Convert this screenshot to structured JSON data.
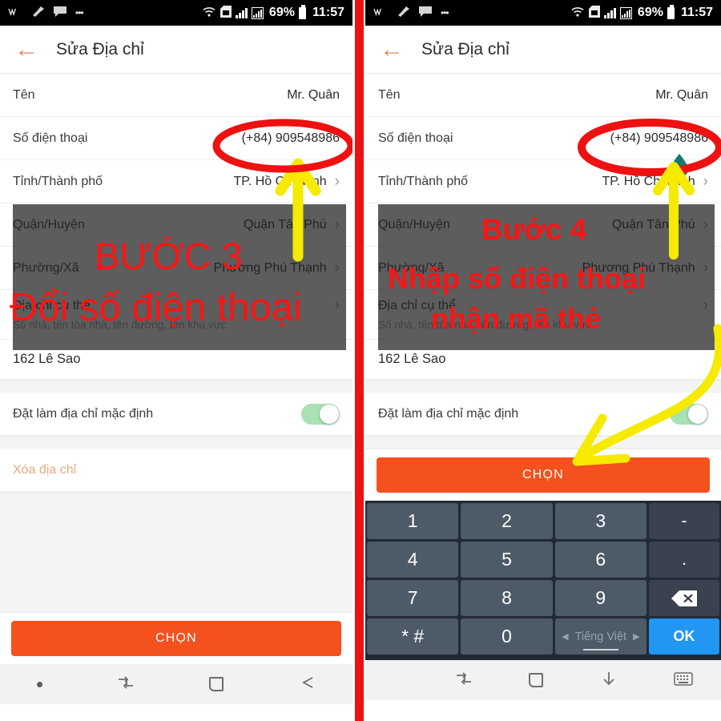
{
  "statusbar": {
    "icons_left": [
      "wifi-share-icon",
      "broom-icon",
      "chat-icon",
      "more-dots-icon"
    ],
    "more_dots": "•••",
    "wifi": "wifi-icon",
    "sdcard": "sdcard-icon",
    "battery_percent": "69%",
    "time": "11:57"
  },
  "header": {
    "back": "←",
    "title": "Sửa Địa chỉ"
  },
  "form": {
    "name": {
      "label": "Tên",
      "value": "Mr. Quân"
    },
    "phone": {
      "label": "Số điện thoại",
      "value": "(+84) 909548986"
    },
    "city": {
      "label": "Tỉnh/Thành phố",
      "value": "TP. Hồ Chí Minh",
      "chevron": "›"
    },
    "district": {
      "label": "Quận/Huyện",
      "value": "Quận Tân Phú",
      "chevron": "›"
    },
    "ward": {
      "label": "Phường/Xã",
      "value": "Phương Phú Thạnh",
      "chevron": "›"
    },
    "address": {
      "label": "Địa chỉ cụ thể",
      "hint": "Số nhà, tên tòa nhà, tên đường, tên khu vực",
      "chevron": "›"
    },
    "street": {
      "value": "162 Lê Sao"
    },
    "default_toggle": {
      "label": "Đặt làm địa chỉ mặc định",
      "state": "on"
    },
    "delete": {
      "label": "Xóa địa chỉ"
    }
  },
  "cta": {
    "label": "CHỌN"
  },
  "navbar_left": {
    "items": [
      "dot-icon",
      "recents-icon",
      "home-icon",
      "back-icon"
    ]
  },
  "navbar_right": {
    "items": [
      "recents-icon",
      "home-icon",
      "hide-keyboard-icon",
      "keyboard-icon"
    ]
  },
  "keypad": {
    "rows": [
      [
        "1",
        "2",
        "3",
        "-"
      ],
      [
        "4",
        "5",
        "6",
        "."
      ],
      [
        "7",
        "8",
        "9",
        "backspace-icon"
      ],
      [
        "* #",
        "0",
        "Tiếng Việt",
        "OK"
      ]
    ],
    "lang_label": "Tiếng Việt",
    "lang_prev": "◀",
    "lang_next": "▶",
    "backspace": "⌫",
    "ok": "OK"
  },
  "annotations": {
    "left": {
      "step": "BƯỚC 3",
      "instruction": "Đổi số điện thoại"
    },
    "right": {
      "step": "Bước 4",
      "instruction_line1": "Nhập số điện thoại",
      "instruction_line2": "nhận mã thẻ"
    },
    "colors": {
      "red": "#fb1414",
      "yellow": "#f5ea00",
      "divider": "#ee1111",
      "accent": "#f4511e",
      "teal": "#11796f"
    }
  }
}
